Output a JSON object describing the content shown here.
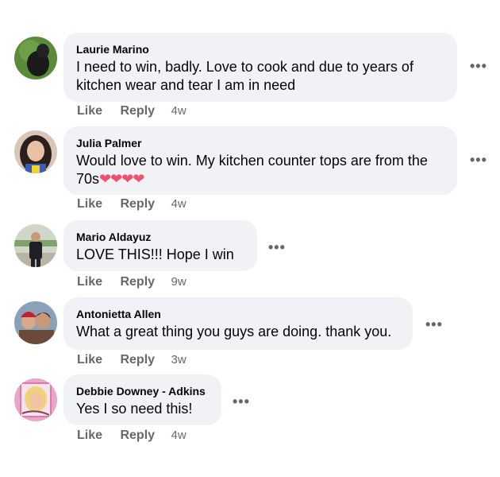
{
  "comments": [
    {
      "author": "Laurie Marino",
      "text": "I need to win, badly. Love to cook and due to years of kitchen wear and tear I am in need",
      "like": "Like",
      "reply": "Reply",
      "time": "4w",
      "more": "•••"
    },
    {
      "author": "Julia Palmer",
      "text": "Would love to win. My kitchen counter tops are from the 70s",
      "emoji": "❤❤❤❤",
      "like": "Like",
      "reply": "Reply",
      "time": "4w",
      "more": "•••"
    },
    {
      "author": "Mario Aldayuz",
      "text": "LOVE THIS!!! Hope I win",
      "like": "Like",
      "reply": "Reply",
      "time": "9w",
      "more": "•••"
    },
    {
      "author": "Antonietta Allen",
      "text": "What a great thing you guys are doing. thank you.",
      "like": "Like",
      "reply": "Reply",
      "time": "3w",
      "more": "•••"
    },
    {
      "author": "Debbie Downey - Adkins",
      "text": "Yes I so need this!",
      "like": "Like",
      "reply": "Reply",
      "time": "4w",
      "more": "•••"
    }
  ],
  "colors": {
    "bubble": "#f0f2f5",
    "meta": "#65676b",
    "heart": "#f0506e"
  }
}
